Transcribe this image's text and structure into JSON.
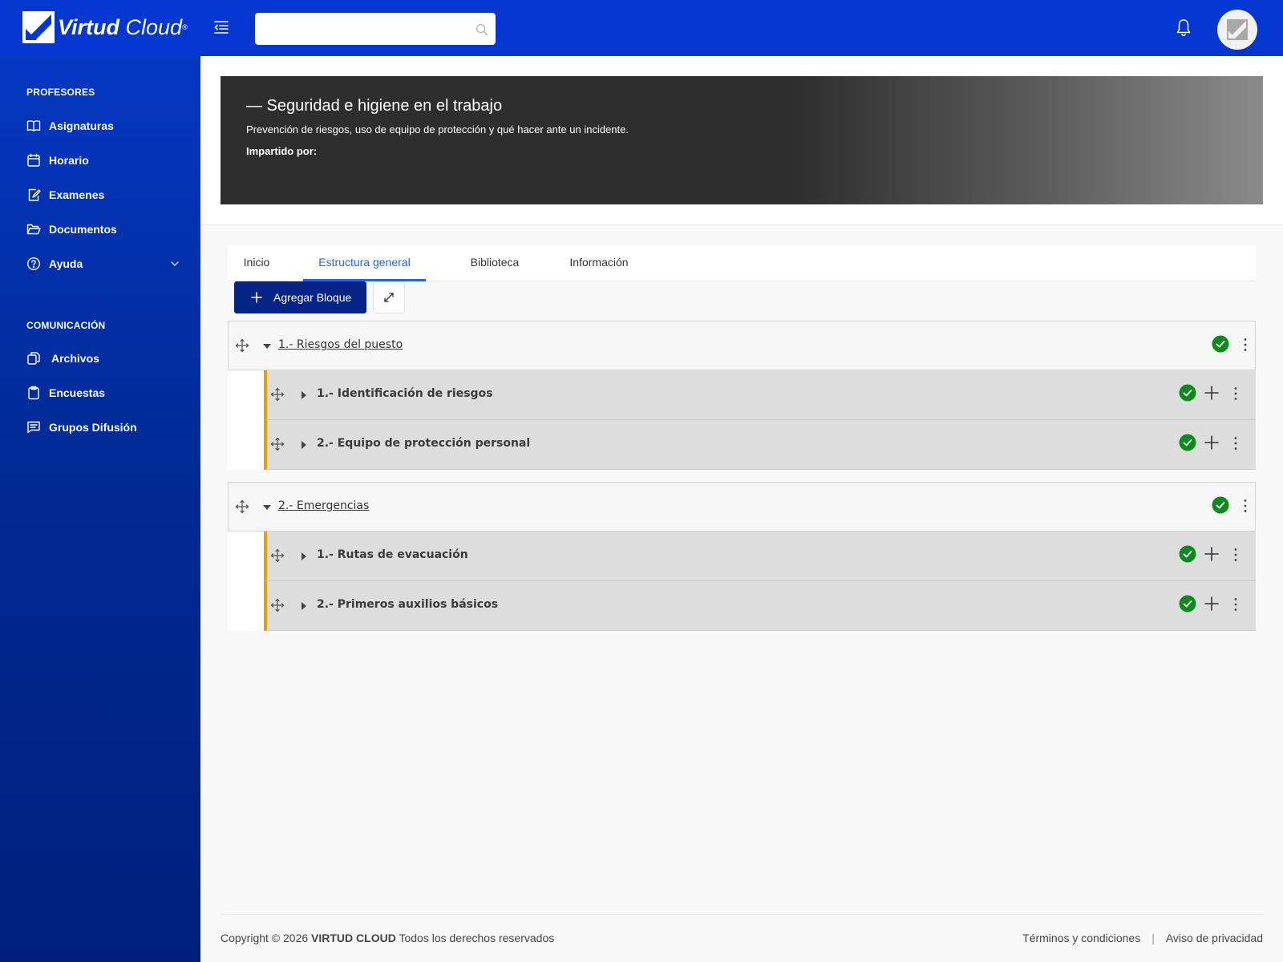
{
  "header": {
    "logo_bold": "Virtud",
    "logo_light": "Cloud",
    "logo_mark": "®",
    "search_placeholder": "",
    "colors": {
      "topbar": "#0437d1",
      "sidebar": "#002a94"
    }
  },
  "sidebar": {
    "sections": [
      {
        "title": "PROFESORES",
        "items": [
          {
            "label": "Asignaturas",
            "icon": "book-open-icon"
          },
          {
            "label": "Horario",
            "icon": "calendar-icon"
          },
          {
            "label": "Examenes",
            "icon": "edit-document-icon"
          },
          {
            "label": "Documentos",
            "icon": "folder-open-icon"
          },
          {
            "label": "Ayuda",
            "icon": "help-circle-icon",
            "expandable": true
          }
        ]
      },
      {
        "title": "COMUNICACIÓN",
        "items": [
          {
            "label": "Archivos",
            "icon": "copy-files-icon"
          },
          {
            "label": "Encuestas",
            "icon": "clipboard-icon"
          },
          {
            "label": "Grupos Difusión",
            "icon": "message-list-icon"
          }
        ]
      }
    ]
  },
  "course": {
    "title": "— Seguridad e higiene en el trabajo",
    "description": "Prevención de riesgos, uso de equipo de protección y qué hacer ante un incidente.",
    "taught_by_label": "Impartido por:"
  },
  "tabs": [
    {
      "label": "Inicio",
      "active": false
    },
    {
      "label": "Estructura general",
      "active": true
    },
    {
      "label": "Biblioteca",
      "active": false
    },
    {
      "label": "Información",
      "active": false
    }
  ],
  "toolbar": {
    "add_block_label": "Agregar Bloque"
  },
  "blocks": [
    {
      "title": "1.- Riesgos del puesto",
      "items": [
        {
          "title": "1.- Identificación de riesgos"
        },
        {
          "title": "2.- Equipo de protección personal"
        }
      ]
    },
    {
      "title": "2.- Emergencias",
      "items": [
        {
          "title": "1.- Rutas de evacuación"
        },
        {
          "title": "2.- Primeros auxilios básicos"
        }
      ]
    }
  ],
  "footer": {
    "copyright_prefix": "Copyright © 2026",
    "brand": "VIRTUD CLOUD",
    "copyright_suffix": "Todos los derechos reservados",
    "terms": "Términos y condiciones",
    "separator": "|",
    "privacy": "Aviso de privacidad"
  }
}
